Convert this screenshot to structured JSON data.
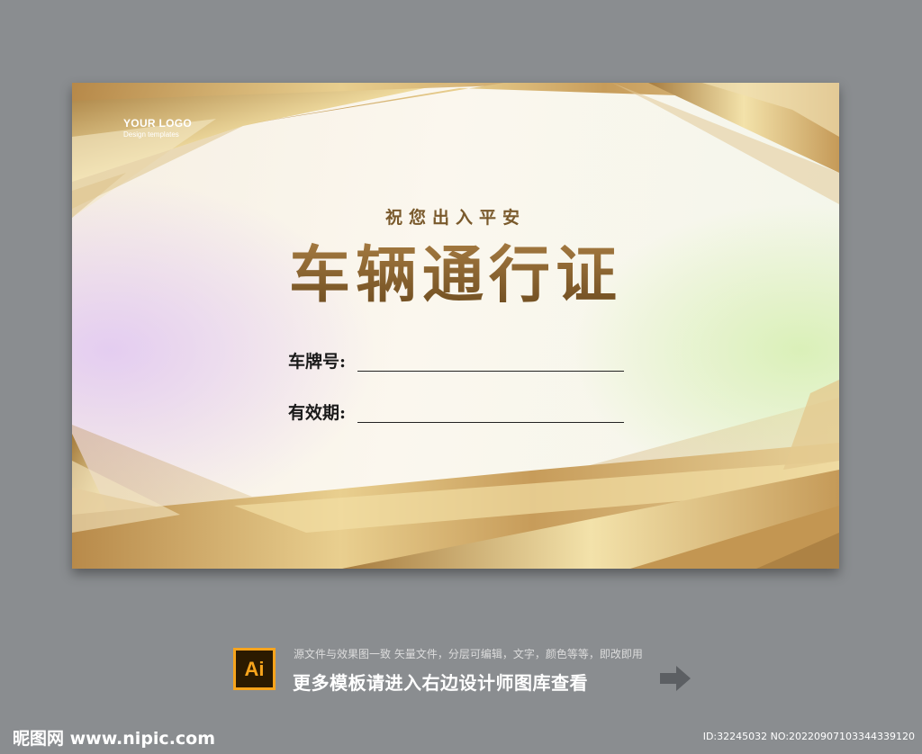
{
  "card": {
    "logo_title": "YOUR LOGO",
    "logo_subtitle": "Design templates",
    "subtitle": "祝您出入平安",
    "title": "车辆通行证",
    "fields": [
      {
        "label": "车牌号:"
      },
      {
        "label": "有效期:"
      }
    ]
  },
  "footer": {
    "ai_badge": "Ai",
    "line1": "源文件与效果图一致 矢量文件，分层可编辑，文字，颜色等等，即改即用",
    "line2": "更多模板请进入右边设计师图库查看",
    "arrow_icon": "arrow-right-icon"
  },
  "watermark": {
    "site": "昵图网 www.nipic.com",
    "id": "ID:32245032 NO:20220907103344339120"
  },
  "colors": {
    "background": "#8a8d90",
    "gold": "#c9a160",
    "title_brown": "#85602d"
  }
}
